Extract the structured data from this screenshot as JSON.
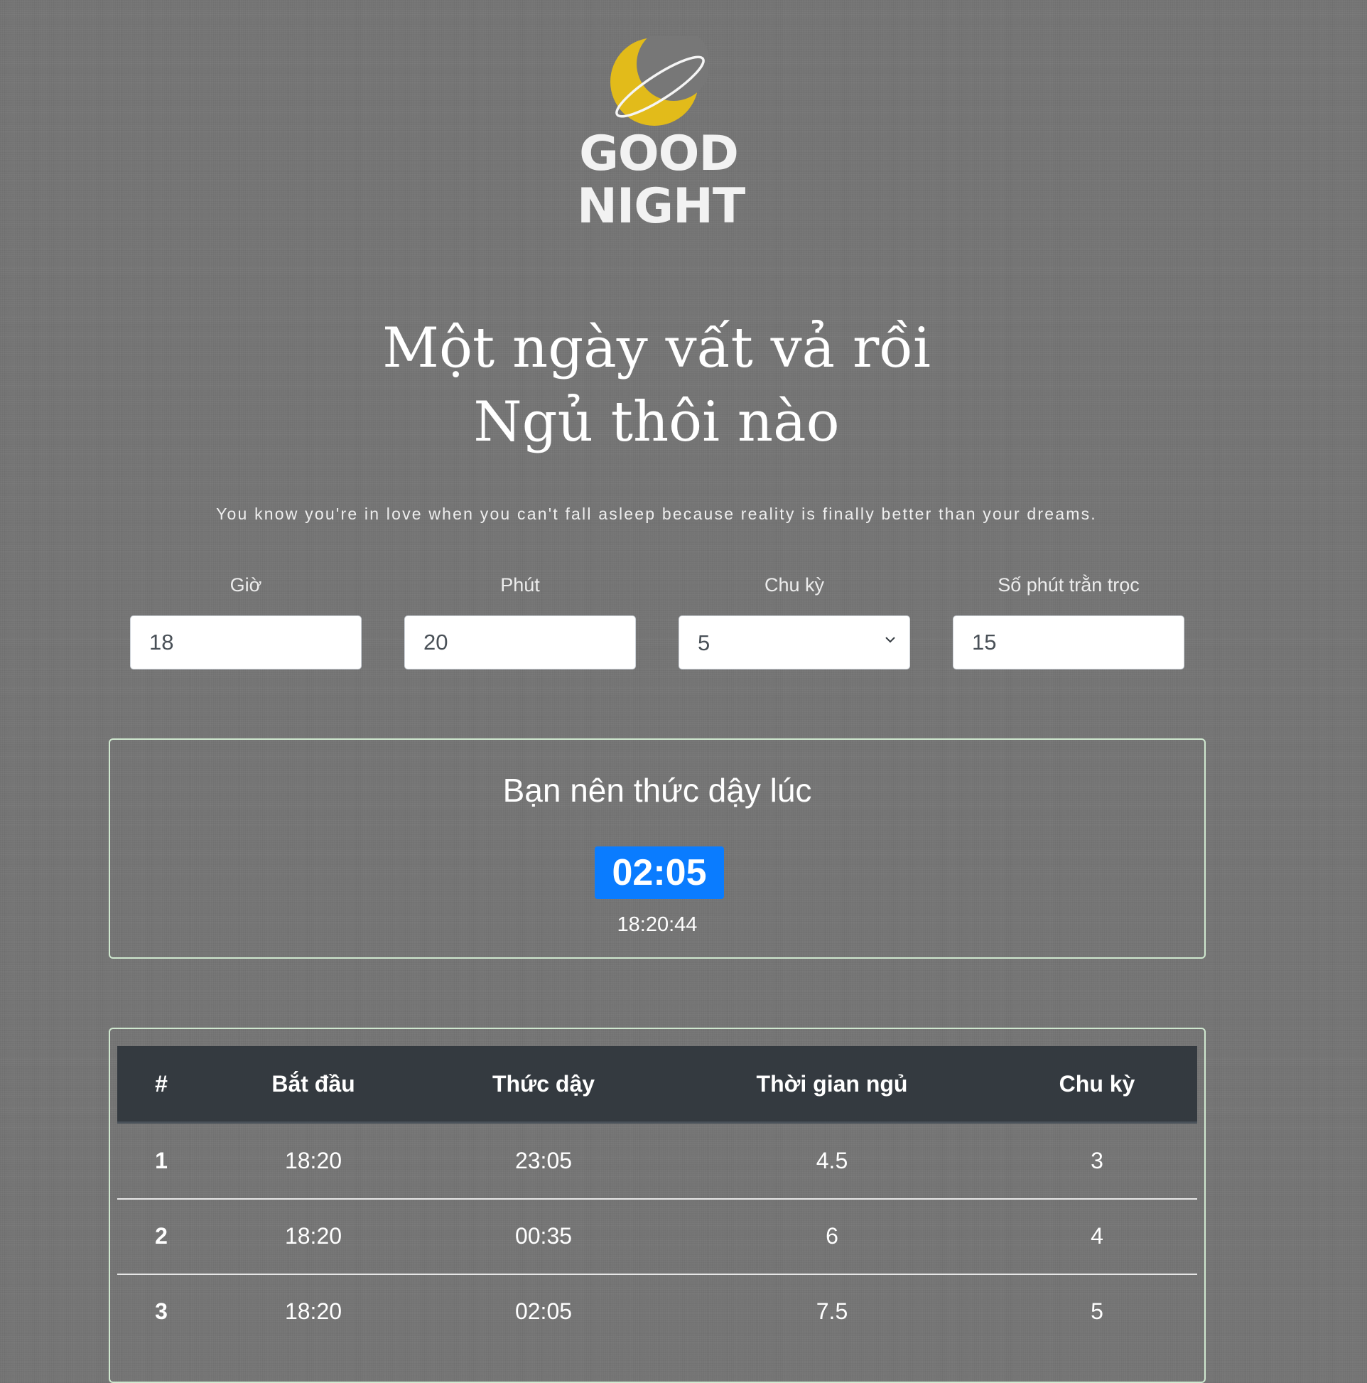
{
  "logo": {
    "line1": "GOOD",
    "line2": "NIGHT",
    "moon_color": "#e2bb1a",
    "icon": "moon-icon"
  },
  "headline": {
    "line1": "Một ngày vất vả rồi",
    "line2": "Ngủ thôi nào"
  },
  "quote": "You know you're in love when you can't fall asleep because reality is finally better than your dreams.",
  "form": {
    "hour": {
      "label": "Giờ",
      "value": "18"
    },
    "minute": {
      "label": "Phút",
      "value": "20"
    },
    "cycles": {
      "label": "Chu kỳ",
      "value": "5"
    },
    "toss_minutes": {
      "label": "Số phút trằn trọc",
      "value": "15"
    }
  },
  "result": {
    "title": "Bạn nên thức dậy lúc",
    "wake_time": "02:05",
    "current_time": "18:20:44",
    "badge_color": "#0a7cff"
  },
  "table": {
    "headers": [
      "#",
      "Bắt đầu",
      "Thức dậy",
      "Thời gian ngủ",
      "Chu kỳ"
    ],
    "rows": [
      [
        "1",
        "18:20",
        "23:05",
        "4.5",
        "3"
      ],
      [
        "2",
        "18:20",
        "00:35",
        "6",
        "4"
      ],
      [
        "3",
        "18:20",
        "02:05",
        "7.5",
        "5"
      ]
    ]
  }
}
